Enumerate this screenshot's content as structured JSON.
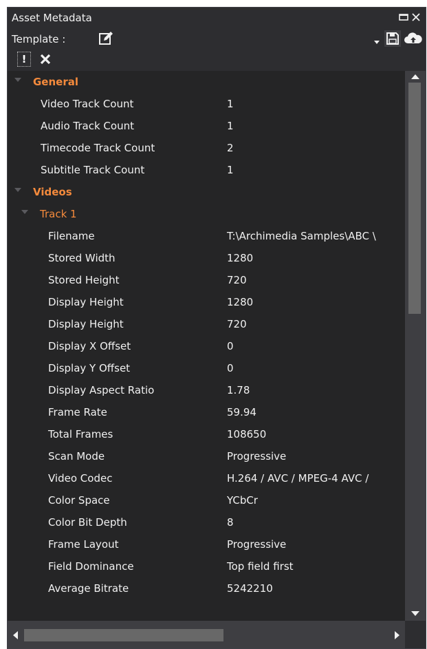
{
  "window": {
    "title": "Asset Metadata"
  },
  "toolbar": {
    "template_label": "Template :"
  },
  "colors": {
    "section": "#f48a3c",
    "text": "#f1f1f1",
    "background": "#252526",
    "panel": "#2d2d30"
  },
  "general": {
    "label": "General",
    "items": [
      {
        "label": "Video Track Count",
        "value": "1"
      },
      {
        "label": "Audio Track Count",
        "value": "1"
      },
      {
        "label": "Timecode Track Count",
        "value": "2"
      },
      {
        "label": "Subtitle Track Count",
        "value": "1"
      }
    ]
  },
  "videos": {
    "label": "Videos",
    "track": {
      "label": "Track 1",
      "items": [
        {
          "label": "Filename",
          "value": "T:\\Archimedia Samples\\ABC \\"
        },
        {
          "label": "Stored Width",
          "value": "1280"
        },
        {
          "label": "Stored Height",
          "value": "720"
        },
        {
          "label": "Display Height",
          "value": "1280"
        },
        {
          "label": "Display Height",
          "value": "720"
        },
        {
          "label": "Display X Offset",
          "value": "0"
        },
        {
          "label": "Display Y Offset",
          "value": "0"
        },
        {
          "label": "Display Aspect Ratio",
          "value": "1.78"
        },
        {
          "label": "Frame Rate",
          "value": "59.94"
        },
        {
          "label": "Total Frames",
          "value": "108650"
        },
        {
          "label": "Scan Mode",
          "value": "Progressive"
        },
        {
          "label": "Video Codec",
          "value": "H.264 / AVC / MPEG-4 AVC /"
        },
        {
          "label": "Color Space",
          "value": "YCbCr"
        },
        {
          "label": "Color Bit Depth",
          "value": "8"
        },
        {
          "label": "Frame Layout",
          "value": "Progressive"
        },
        {
          "label": "Field Dominance",
          "value": "Top field first"
        },
        {
          "label": "Average Bitrate",
          "value": "5242210"
        }
      ]
    }
  }
}
